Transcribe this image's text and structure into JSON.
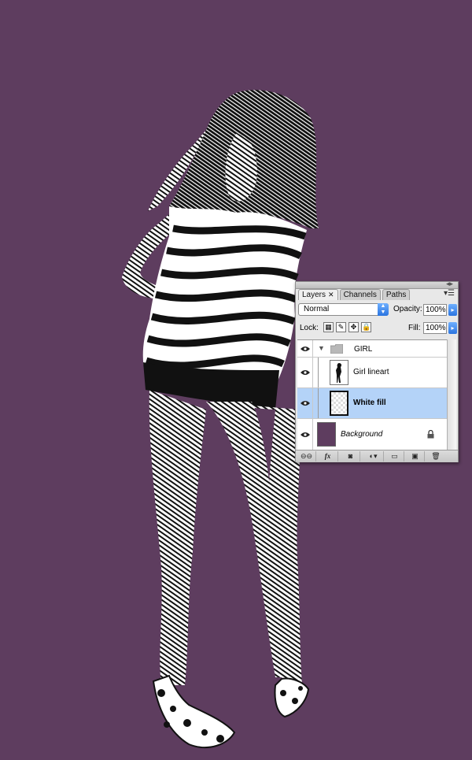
{
  "canvas": {
    "background_color": "#5e3d5f",
    "artwork": "halftone-line-art-girl-figure"
  },
  "layers_panel": {
    "tabs": [
      {
        "label": "Layers",
        "active": true
      },
      {
        "label": "Channels",
        "active": false
      },
      {
        "label": "Paths",
        "active": false
      }
    ],
    "blend_mode": "Normal",
    "opacity_label": "Opacity:",
    "opacity_value": "100%",
    "lock_label": "Lock:",
    "fill_label": "Fill:",
    "fill_value": "100%",
    "layers": [
      {
        "name": "GIRL",
        "type": "group",
        "visible": true,
        "expanded": true,
        "selected": false
      },
      {
        "name": "Girl lineart",
        "type": "layer",
        "visible": true,
        "selected": false
      },
      {
        "name": "White fill",
        "type": "layer",
        "visible": true,
        "selected": true
      },
      {
        "name": "Background",
        "type": "background",
        "visible": true,
        "locked": true,
        "selected": false
      }
    ],
    "colors": {
      "selection": "#b4d3f8",
      "background_swatch": "#5e3d5f",
      "accent_blue": "#2a74e0"
    },
    "bottom_icons": [
      "link-icon",
      "fx-icon",
      "mask-icon",
      "adjustment-icon",
      "new-group-icon",
      "new-layer-icon",
      "trash-icon"
    ],
    "fx_label": "fx"
  }
}
